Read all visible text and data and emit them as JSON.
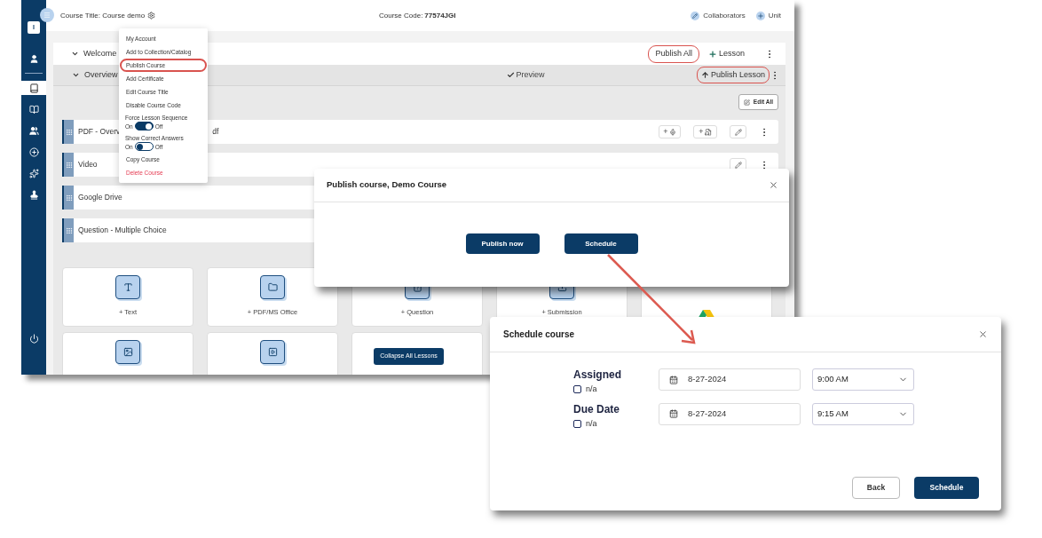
{
  "sidebar": {
    "logo": "I",
    "items": [
      {
        "kind": "user",
        "selected": false
      },
      {
        "kind": "course",
        "selected": true
      },
      {
        "kind": "book",
        "selected": false
      },
      {
        "kind": "people",
        "selected": false
      },
      {
        "kind": "add",
        "selected": false
      },
      {
        "kind": "sparkle",
        "selected": false
      },
      {
        "kind": "stamp",
        "selected": false
      }
    ]
  },
  "header": {
    "course_title": "Course Title: Course demo",
    "course_code_label": "Course Code:",
    "course_code": "77574JGI",
    "actions": [
      {
        "kind": "collaborators",
        "label": "Collaborators"
      },
      {
        "kind": "unit",
        "label": "Unit"
      }
    ]
  },
  "unit": {
    "title": "Welcome",
    "expanded": true,
    "publish_all": {
      "label": "Publish All",
      "highlighted": true
    },
    "add_lesson": "Lesson"
  },
  "lesson": {
    "title": "Overview",
    "expanded": true,
    "preview": "Preview",
    "publish_lesson": {
      "label": "Publish Lesson",
      "highlighted": true
    }
  },
  "edit_all": "Edit All",
  "content_items": [
    {
      "title": "PDF - Overv",
      "title_tail": "df",
      "actions": [
        {
          "kind": "audio",
          "label": "+"
        },
        {
          "kind": "attach",
          "label": "+"
        },
        {
          "kind": "edit"
        }
      ]
    },
    {
      "title": "Video",
      "actions": [
        {
          "kind": "edit"
        }
      ]
    },
    {
      "title": "Google Drive"
    },
    {
      "title": "Question - Multiple Choice"
    }
  ],
  "tiles": [
    {
      "kind": "text",
      "label": "+ Text"
    },
    {
      "kind": "pdf",
      "label": "+ PDF/MS Office"
    },
    {
      "kind": "question",
      "label": "+ Question"
    },
    {
      "kind": "submission",
      "label": "+ Submission"
    },
    {
      "kind": "drive"
    },
    {
      "kind": "image"
    },
    {
      "kind": "video"
    },
    {
      "kind": "blank"
    }
  ],
  "collapse_button": "Collapse All Lessons",
  "menu": {
    "items": [
      {
        "kind": "action",
        "label": "My Account",
        "highlighted": false
      },
      {
        "kind": "action",
        "label": "Add to Collection/Catalog",
        "highlighted": false
      },
      {
        "kind": "action",
        "label": "Publish Course",
        "highlighted": true
      },
      {
        "kind": "action",
        "label": "Add Certificate",
        "highlighted": false
      },
      {
        "kind": "action",
        "label": "Edit Course Title",
        "highlighted": false
      },
      {
        "kind": "action",
        "label": "Disable Course Code",
        "highlighted": false
      },
      {
        "kind": "toggle",
        "label": "Force Lesson Sequence",
        "on_label": "On",
        "off_label": "Off",
        "on": true,
        "highlighted": false
      },
      {
        "kind": "toggle",
        "label": "Show Correct Answers",
        "on_label": "On",
        "off_label": "Off",
        "on": false,
        "highlighted": false
      },
      {
        "kind": "action",
        "label": "Copy Course",
        "highlighted": false
      },
      {
        "kind": "danger",
        "label": "Delete Course",
        "highlighted": false
      }
    ]
  },
  "publish_dialog": {
    "title": "Publish course, Demo Course",
    "buttons": [
      {
        "label": "Publish now"
      },
      {
        "label": "Schedule"
      }
    ]
  },
  "schedule_dialog": {
    "title": "Schedule course",
    "rows": [
      {
        "label": "Assigned",
        "na_label": "n/a",
        "na_checked": false,
        "date": "8-27-2024",
        "time": "9:00 AM"
      },
      {
        "label": "Due Date",
        "na_label": "n/a",
        "na_checked": false,
        "date": "8-27-2024",
        "time": "9:15 AM"
      }
    ],
    "buttons": [
      {
        "kind": "secondary",
        "label": "Back"
      },
      {
        "kind": "primary",
        "label": "Schedule"
      }
    ]
  }
}
